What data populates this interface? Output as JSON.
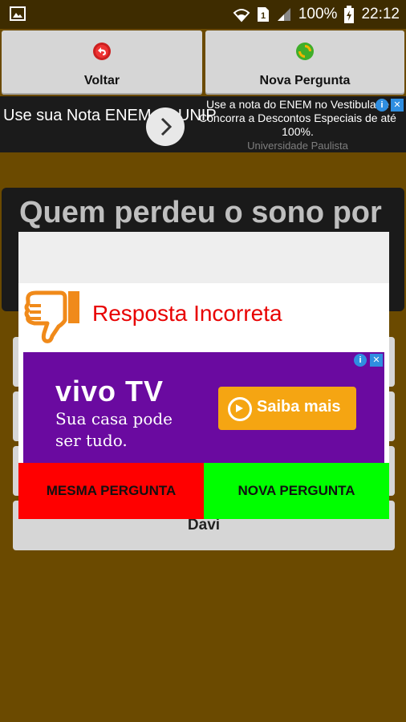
{
  "status_bar": {
    "battery": "100%",
    "time": "22:12"
  },
  "toolbar": {
    "back_label": "Voltar",
    "new_question_label": "Nova Pergunta"
  },
  "top_ad": {
    "headline": "Use sua Nota ENEM na UNIP",
    "text": "Use a nota do ENEM no Vestibular e Concorra a Descontos Especiais de até 100%.",
    "advertiser": "Universidade Paulista"
  },
  "question": {
    "text": "Quem perdeu o sono por"
  },
  "answers": [
    "",
    "",
    "",
    "Davi"
  ],
  "dialog": {
    "result": "Resposta Incorreta",
    "ad": {
      "brand": "vivo TV",
      "slogan_line1": "Sua casa pode",
      "slogan_line2": "ser tudo.",
      "cta": "Saiba mais"
    },
    "same_question_label": "MESMA PERGUNTA",
    "new_question_label": "NOVA PERGUNTA"
  },
  "colors": {
    "background": "#6b4a00",
    "incorrect_text": "#e80000",
    "same_button": "#ff0000",
    "new_button": "#00ff00",
    "ad_purple": "#6a0aa0",
    "cta_orange": "#f5a512"
  }
}
